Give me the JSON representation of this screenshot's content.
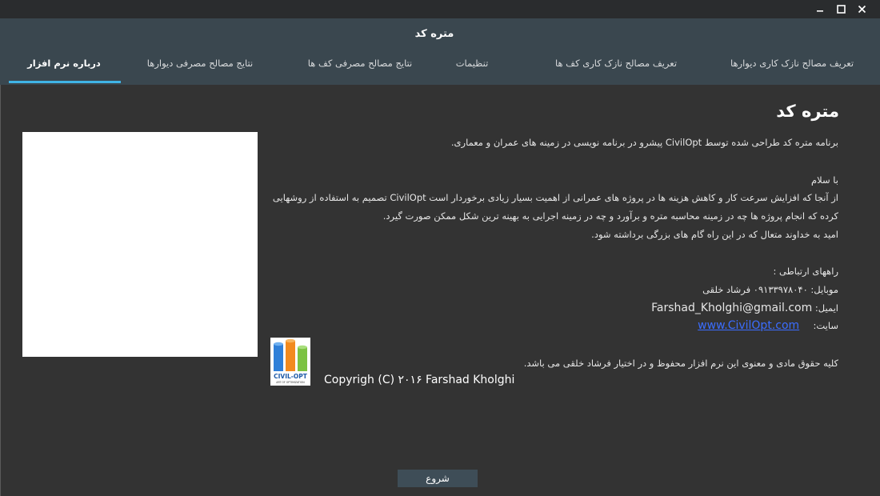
{
  "window": {
    "minimize_icon": "minimize-icon",
    "maximize_icon": "maximize-icon",
    "close_icon": "close-icon"
  },
  "header": {
    "app_title": "متره کد"
  },
  "tabs": [
    {
      "label": "تعریف مصالح نازک کاری دیوارها",
      "active": false
    },
    {
      "label": "تعریف مصالح نازک کاری کف ها",
      "active": false
    },
    {
      "label": "تنظیمات",
      "active": false
    },
    {
      "label": "نتایج مصالح مصرفی کف ها",
      "active": false
    },
    {
      "label": "نتایج مصالح مصرفی دیوارها",
      "active": false
    },
    {
      "label": "درباره نرم افزار",
      "active": true
    }
  ],
  "about": {
    "heading": "متره کد",
    "intro": "برنامه متره کد طراحی شده توسط CivilOpt پیشرو در برنامه نویسی در زمینه های عمران و معماری.",
    "greeting": "با سلام",
    "para_line1": "از آنجا که افزایش سرعت کار و کاهش هزینه ها در پروژه های عمرانی از اهمیت بسیار زیادی برخوردار است CivilOpt تصمیم به استفاده از روشهایی",
    "para_line2": "کرده که انجام پروژه ها چه در زمینه محاسبه متره و برآورد و چه در زمینه اجرایی به بهینه ترین شکل ممکن صورت گیرد.",
    "para_line3": "امید به خداوند متعال  که در این راه گام های بزرگی برداشته شود.",
    "contact_title": "راههای ارتباطی :",
    "mobile": "موبایل: ۰۹۱۳۳۹۷۸۰۴۰ فرشاد خلقی",
    "email_label": "ایمیل:",
    "email": "Farshad_Kholghi@gmail.com",
    "site_label": "سایت:",
    "site": "www.CivilOpt.com",
    "rights": "کلیه حقوق مادی و معنوی این نرم افزار محفوظ و در اختیار فرشاد خلقی می باشد.",
    "copyright": "Copyrigh (C) ۲۰۱۶ Farshad Kholghi",
    "logo_text": "CIVIL-OPT",
    "logo_subtext": "ART OF OPTIMIZATION"
  },
  "footer": {
    "start_label": "شروع"
  },
  "colors": {
    "accent": "#40b4e6",
    "header_bg": "#3a474f",
    "body_bg": "#333333",
    "link": "#3b6dff"
  }
}
